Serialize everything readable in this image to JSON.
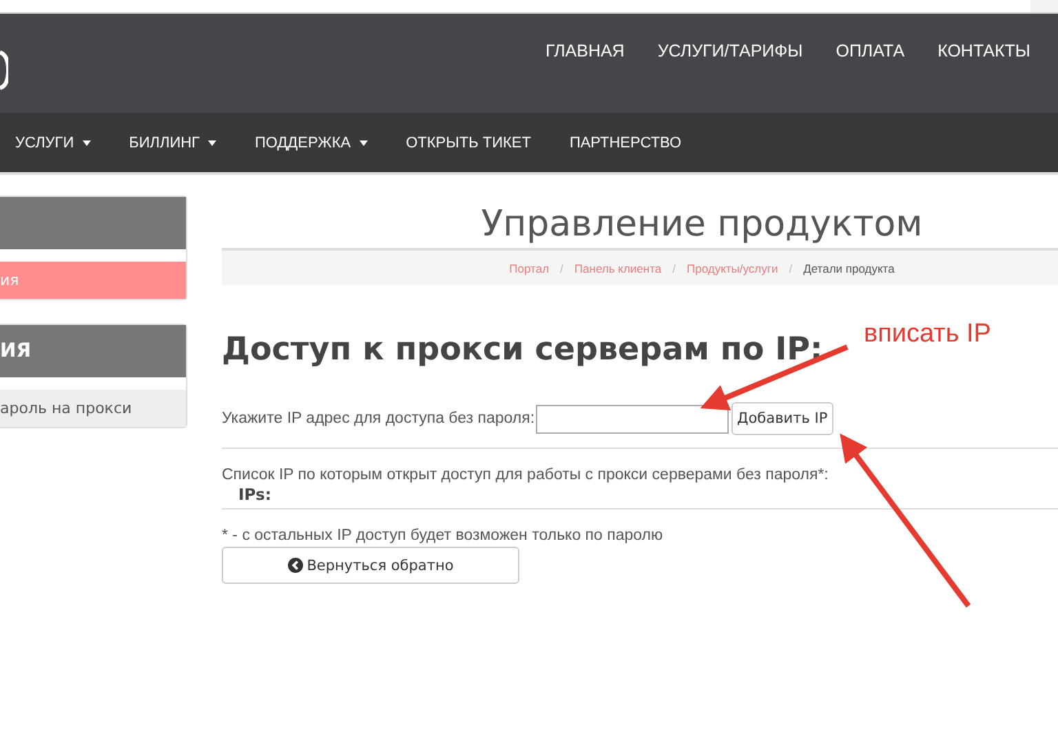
{
  "header": {
    "nav": [
      {
        "label": "ГЛАВНАЯ"
      },
      {
        "label": "УСЛУГИ/ТАРИФЫ"
      },
      {
        "label": "ОПЛАТА"
      },
      {
        "label": "КОНТАКТЫ"
      }
    ]
  },
  "menu": [
    {
      "label": "УСЛУГИ",
      "dropdown": true
    },
    {
      "label": "БИЛЛИНГ",
      "dropdown": true
    },
    {
      "label": "ПОДДЕРЖКА",
      "dropdown": true
    },
    {
      "label": "ОТКРЫТЬ ТИКЕТ",
      "dropdown": false
    },
    {
      "label": "ПАРТНЕРСТВО",
      "dropdown": false
    }
  ],
  "sidebar": [
    {
      "items": [
        {
          "label": "ия",
          "selected": true
        }
      ]
    },
    {
      "title": "ИЯ",
      "items": [
        {
          "label": "ароль на прокси",
          "selected": false
        }
      ]
    }
  ],
  "page_title": "Управление продуктом",
  "breadcrumb": [
    {
      "label": "Портал",
      "link": true
    },
    {
      "separator": "/",
      "label": "Панель клиента",
      "link": true
    },
    {
      "separator": "/",
      "label": "Продукты/услуги",
      "link": true
    },
    {
      "separator": "/",
      "label": "Детали продукта",
      "link": false
    }
  ],
  "heading": "Доступ к прокси серверам по IP:",
  "ip_form": {
    "label": "Укажите IP адрес для доступа без пароля:",
    "button": "Добавить IP"
  },
  "list_text": "Список IP по которым открыт доступ для работы с прокси серверами без пароля*:",
  "ips_label": "IPs:",
  "note": "* - с остальных IP доступ будет возможен только по паролю",
  "back_button": "Вернуться обратно",
  "annotation": "вписать IP"
}
